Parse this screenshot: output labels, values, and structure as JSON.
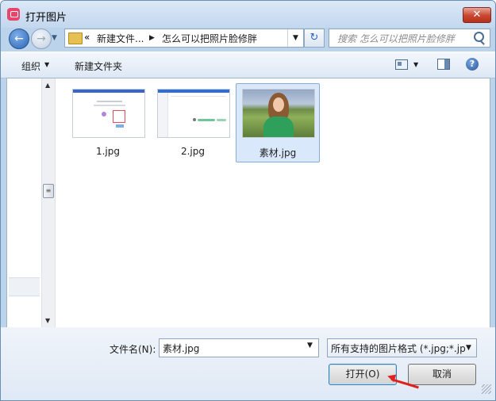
{
  "window": {
    "title": "打开图片",
    "close_glyph": "✕"
  },
  "nav": {
    "back_glyph": "←",
    "forward_glyph": "→",
    "address": {
      "prefix": "«",
      "segments": [
        "新建文件...",
        "怎么可以把照片脸修胖"
      ],
      "separator": "▶",
      "dropdown_glyph": "▼"
    },
    "refresh_glyph": "↻",
    "search_placeholder": "搜索 怎么可以把照片脸修胖"
  },
  "toolbar": {
    "organize_label": "组织",
    "organize_arrow": "▼",
    "new_folder_label": "新建文件夹",
    "view_dropdown_glyph": "▼",
    "help_glyph": "?"
  },
  "scrollbar": {
    "up_glyph": "▲",
    "down_glyph": "▼",
    "thumb_glyph": "≡"
  },
  "files": [
    {
      "name": "1.jpg",
      "selected": false
    },
    {
      "name": "2.jpg",
      "selected": false
    },
    {
      "name": "素材.jpg",
      "selected": true
    }
  ],
  "bottom": {
    "filename_label": "文件名(N):",
    "filename_value": "素材.jpg",
    "filename_dd_glyph": "▼",
    "filetype_value": "所有支持的图片格式 (*.jpg;*.jp",
    "filetype_dd_glyph": "▼",
    "open_label": "打开(O)",
    "cancel_label": "取消"
  },
  "watermark_text": "Baidu",
  "colors": {
    "accent": "#2c63b4",
    "selection": "#d9e8fb",
    "annotation_arrow": "#e0201a"
  }
}
